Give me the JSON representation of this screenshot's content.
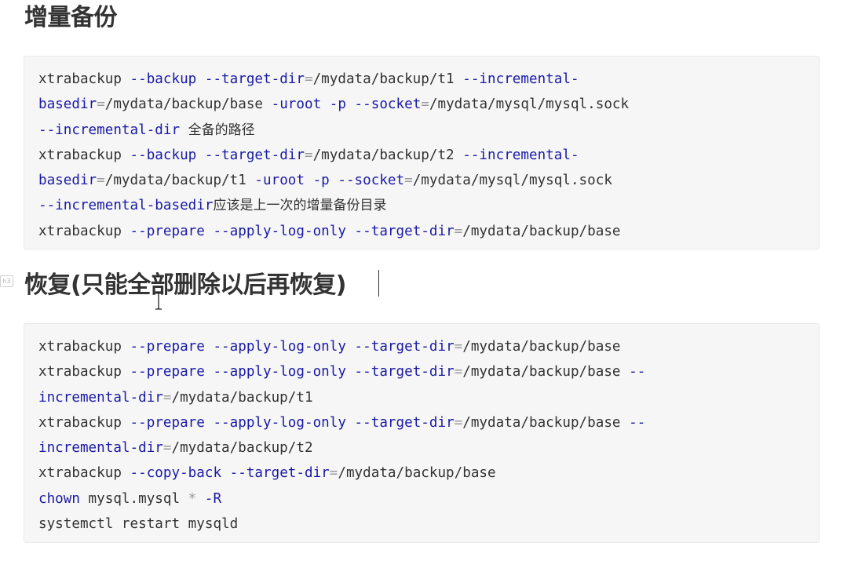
{
  "sections": {
    "incremental": {
      "title": "增量备份",
      "lines": [
        [
          [
            "xtrabackup ",
            "txt"
          ],
          [
            "--backup",
            "flag"
          ],
          [
            " ",
            "txt"
          ],
          [
            "--target-dir",
            "flag"
          ],
          [
            "=",
            "op"
          ],
          [
            "/mydata/backup/t1 ",
            "txt"
          ],
          [
            "--incremental-",
            "flag"
          ]
        ],
        [
          [
            "basedir",
            "flag"
          ],
          [
            "=",
            "op"
          ],
          [
            "/mydata/backup/base ",
            "txt"
          ],
          [
            "-uroot",
            "flag"
          ],
          [
            " ",
            "txt"
          ],
          [
            "-p",
            "flag"
          ],
          [
            " ",
            "txt"
          ],
          [
            "--socket",
            "flag"
          ],
          [
            "=",
            "op"
          ],
          [
            "/mydata/mysql/mysql.sock",
            "txt"
          ]
        ],
        [
          [
            "--incremental-dir",
            "flag"
          ],
          [
            " ",
            "txt"
          ],
          [
            "全备的路径",
            "cjk"
          ]
        ],
        [
          [
            "xtrabackup ",
            "txt"
          ],
          [
            "--backup",
            "flag"
          ],
          [
            " ",
            "txt"
          ],
          [
            "--target-dir",
            "flag"
          ],
          [
            "=",
            "op"
          ],
          [
            "/mydata/backup/t2 ",
            "txt"
          ],
          [
            "--incremental-",
            "flag"
          ]
        ],
        [
          [
            "basedir",
            "flag"
          ],
          [
            "=",
            "op"
          ],
          [
            "/mydata/backup/t1 ",
            "txt"
          ],
          [
            "-uroot",
            "flag"
          ],
          [
            " ",
            "txt"
          ],
          [
            "-p",
            "flag"
          ],
          [
            " ",
            "txt"
          ],
          [
            "--socket",
            "flag"
          ],
          [
            "=",
            "op"
          ],
          [
            "/mydata/mysql/mysql.sock",
            "txt"
          ]
        ],
        [
          [
            "--incremental-basedir",
            "flag"
          ],
          [
            "应该是上一次的增量备份目录",
            "cjk"
          ]
        ],
        [
          [
            "xtrabackup ",
            "txt"
          ],
          [
            "--prepare",
            "flag"
          ],
          [
            " ",
            "txt"
          ],
          [
            "--apply-log-only",
            "flag"
          ],
          [
            " ",
            "txt"
          ],
          [
            "--target-dir",
            "flag"
          ],
          [
            "=",
            "op"
          ],
          [
            "/mydata/backup/base",
            "txt"
          ]
        ]
      ]
    },
    "restore": {
      "badge": "h3",
      "title": "恢复(只能全部删除以后再恢复)",
      "lines": [
        [
          [
            "xtrabackup ",
            "txt"
          ],
          [
            "--prepare",
            "flag"
          ],
          [
            " ",
            "txt"
          ],
          [
            "--apply-log-only",
            "flag"
          ],
          [
            " ",
            "txt"
          ],
          [
            "--target-dir",
            "flag"
          ],
          [
            "=",
            "op"
          ],
          [
            "/mydata/backup/base",
            "txt"
          ]
        ],
        [
          [
            "xtrabackup ",
            "txt"
          ],
          [
            "--prepare",
            "flag"
          ],
          [
            " ",
            "txt"
          ],
          [
            "--apply-log-only",
            "flag"
          ],
          [
            " ",
            "txt"
          ],
          [
            "--target-dir",
            "flag"
          ],
          [
            "=",
            "op"
          ],
          [
            "/mydata/backup/base ",
            "txt"
          ],
          [
            "--",
            "flag"
          ]
        ],
        [
          [
            "incremental-dir",
            "flag"
          ],
          [
            "=",
            "op"
          ],
          [
            "/mydata/backup/t1",
            "txt"
          ]
        ],
        [
          [
            "xtrabackup ",
            "txt"
          ],
          [
            "--prepare",
            "flag"
          ],
          [
            " ",
            "txt"
          ],
          [
            "--apply-log-only",
            "flag"
          ],
          [
            " ",
            "txt"
          ],
          [
            "--target-dir",
            "flag"
          ],
          [
            "=",
            "op"
          ],
          [
            "/mydata/backup/base ",
            "txt"
          ],
          [
            "--",
            "flag"
          ]
        ],
        [
          [
            "incremental-dir",
            "flag"
          ],
          [
            "=",
            "op"
          ],
          [
            "/mydata/backup/t2",
            "txt"
          ]
        ],
        [
          [
            "xtrabackup ",
            "txt"
          ],
          [
            "--copy-back",
            "flag"
          ],
          [
            " ",
            "txt"
          ],
          [
            "--target-dir",
            "flag"
          ],
          [
            "=",
            "op"
          ],
          [
            "/mydata/backup/base",
            "txt"
          ]
        ],
        [
          [
            "chown",
            "kw"
          ],
          [
            " mysql.mysql ",
            "txt"
          ],
          [
            "*",
            "op"
          ],
          [
            " ",
            "txt"
          ],
          [
            "-R",
            "flag"
          ]
        ],
        [
          [
            "systemctl restart mysqld",
            "txt"
          ]
        ]
      ]
    }
  }
}
